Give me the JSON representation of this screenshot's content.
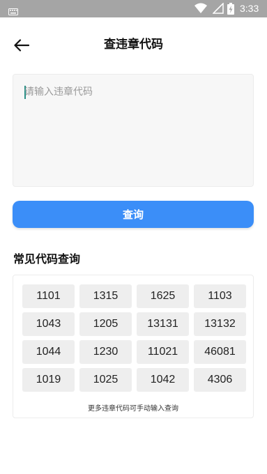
{
  "status_bar": {
    "time": "3:33"
  },
  "header": {
    "title": "查违章代码"
  },
  "search": {
    "placeholder": "请输入违章代码",
    "value": ""
  },
  "query_button": {
    "label": "查询"
  },
  "common_codes": {
    "title": "常见代码查询",
    "codes": [
      "1101",
      "1315",
      "1625",
      "1103",
      "1043",
      "1205",
      "13131",
      "13132",
      "1044",
      "1230",
      "11021",
      "46081",
      "1019",
      "1025",
      "1042",
      "4306"
    ],
    "footnote": "更多违章代码可手动输入查询"
  },
  "colors": {
    "accent": "#3b8ef8",
    "status_bar": "#a5a5a5",
    "chip_bg": "#eeeeee"
  }
}
